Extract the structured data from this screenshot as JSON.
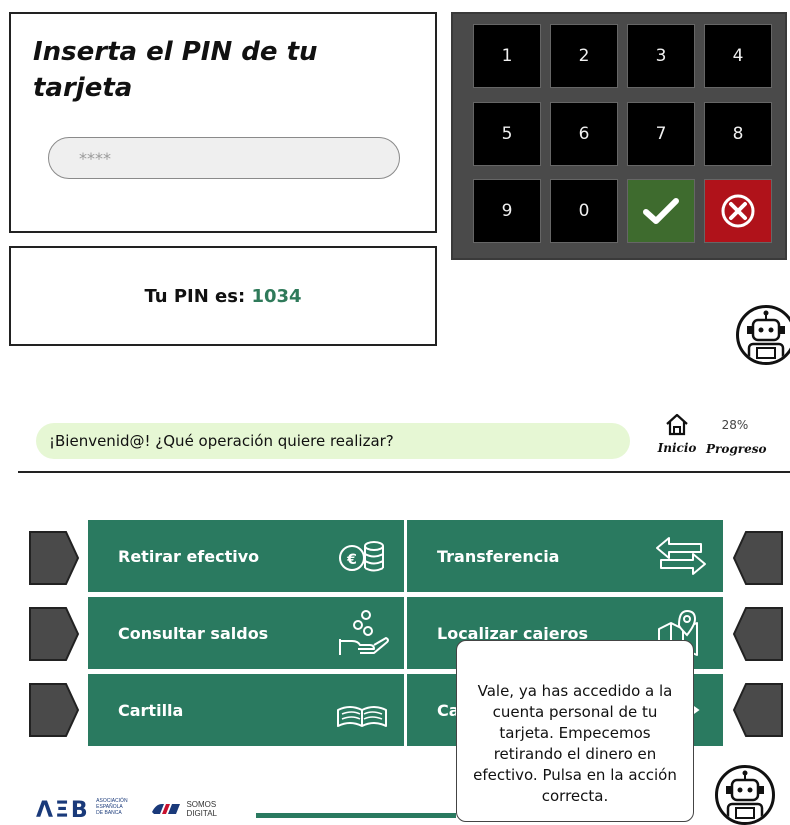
{
  "pin_panel": {
    "title": "Inserta el PIN de tu tarjeta",
    "input_placeholder": "****"
  },
  "pin_info": {
    "label": "Tu PIN es:",
    "value": "1034"
  },
  "keypad": {
    "keys": [
      "1",
      "2",
      "3",
      "4",
      "5",
      "6",
      "7",
      "8",
      "9",
      "0"
    ],
    "confirm_icon": "check-icon",
    "cancel_icon": "cancel-icon",
    "colors": {
      "confirm": "#3e6b2e",
      "cancel": "#b0121a",
      "key": "#000000"
    }
  },
  "atm": {
    "welcome": "¡Bienvenid@! ¿Qué operación quiere realizar?",
    "home_label": "Inicio",
    "progress_label": "Progreso",
    "progress_value": "28%",
    "operations": [
      {
        "label": "Retirar efectivo",
        "icon": "coins-euro-icon"
      },
      {
        "label": "Transferencia",
        "icon": "transfer-arrows-icon"
      },
      {
        "label": "Consultar saldos",
        "icon": "hand-coins-icon"
      },
      {
        "label": "Localizar cajeros",
        "icon": "map-pin-icon"
      },
      {
        "label": "Cartilla",
        "icon": "open-book-icon"
      },
      {
        "label": "Ca",
        "icon": "arrow-icon"
      }
    ],
    "tooltip": "Vale, ya has accedido a la cuenta personal de tu tarjeta. Empecemos retirando el dinero en efectivo. Pulsa en la acción correcta.",
    "accent_color": "#2a7a60"
  },
  "footer": {
    "logo_aeb": "ΛΞB",
    "logo_aeb_sub": [
      "ASOCIACIÓN",
      "ESPAÑOLA",
      "DE BANCA"
    ],
    "logo_somos": "SOMOS",
    "logo_digital": "DIGITAL"
  }
}
